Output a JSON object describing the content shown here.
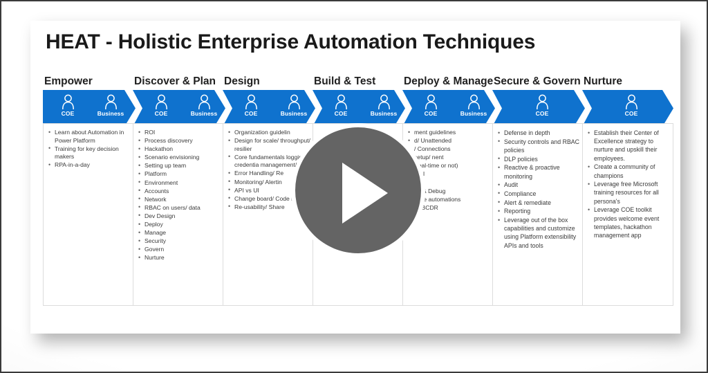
{
  "slide": {
    "title": "HEAT - Holistic Enterprise Automation Techniques",
    "accent_color": "#0f72ce",
    "text_color": "#3a3a3a",
    "card_border_color": "#dcdcdc"
  },
  "media": {
    "play_button": {
      "icon": "play-triangle-icon",
      "circle_color": "#646464",
      "triangle_color": "#ffffff",
      "halo_color": "#ffffff"
    }
  },
  "phases": [
    {
      "name": "Empower",
      "shape": "pointed",
      "personas": [
        {
          "icon": "person-icon",
          "label": "COE"
        },
        {
          "icon": "person-icon",
          "label": "Business"
        }
      ],
      "items": [
        "Learn about Automation in Power Platform",
        "Training for key decision makers",
        "RPA-in-a-day"
      ]
    },
    {
      "name": "Discover & Plan",
      "shape": "notched",
      "personas": [
        {
          "icon": "person-icon",
          "label": "COE"
        },
        {
          "icon": "person-icon",
          "label": "Business"
        }
      ],
      "items": [
        "ROI",
        "Process discovery",
        "Hackathon",
        "Scenario envisioning",
        "Setting up team",
        "Platform",
        "Environment",
        "Accounts",
        "Network",
        "RBAC on users/ data",
        "Dev Design",
        "Deploy",
        "Manage",
        "Security",
        "Govern",
        "Nurture"
      ]
    },
    {
      "name": "Design",
      "shape": "notched",
      "personas": [
        {
          "icon": "person-icon",
          "label": "COE"
        },
        {
          "icon": "person-icon",
          "label": "Business"
        }
      ],
      "items": [
        "Organization guidelin",
        "Design for scale/ throughput/ resilier",
        "Core fundamentals logging/ credentia management/ test",
        "Error Handling/ Re",
        "Monitoring/ Alertin",
        "API vs UI",
        "Change board/ Code review",
        "Re-usability/ Share"
      ]
    },
    {
      "name": "Build & Test",
      "shape": "notched",
      "personas": [
        {
          "icon": "person-icon",
          "label": "COE"
        },
        {
          "icon": "person-icon",
          "label": "Business"
        }
      ],
      "items": []
    },
    {
      "name": "Deploy & Manage",
      "shape": "notched",
      "personas": [
        {
          "icon": "person-icon",
          "label": "COE"
        },
        {
          "icon": "person-icon",
          "label": "Business"
        }
      ],
      "items": [
        "ment guidelines",
        "d/ Unattended",
        "/ Connections",
        "setup/ nent",
        "(real-time or not)",
        "ROI",
        "e",
        "ng & Debug",
        "mize automations",
        "A/ BCDR"
      ]
    },
    {
      "name": "Secure & Govern",
      "shape": "notched",
      "personas": [
        {
          "icon": "person-icon",
          "label": "COE"
        }
      ],
      "items": [
        "Defense in depth",
        "Security controls and RBAC policies",
        "DLP policies",
        "Reactive & proactive monitoring",
        "Audit",
        "Compliance",
        "Alert & remediate",
        "Reporting",
        "Leverage out of the box capabilities and customize using Platform extensibility APIs and tools"
      ]
    },
    {
      "name": "Nurture",
      "shape": "notched",
      "personas": [
        {
          "icon": "person-icon",
          "label": "COE"
        }
      ],
      "items": [
        "Establish their Center of Excellence strategy to nurture and upskill their employees.",
        "Create a community of champions",
        "Leverage free Microsoft training resources for all persona's",
        "Leverage COE toolkit provides welcome event templates, hackathon management app"
      ]
    }
  ]
}
